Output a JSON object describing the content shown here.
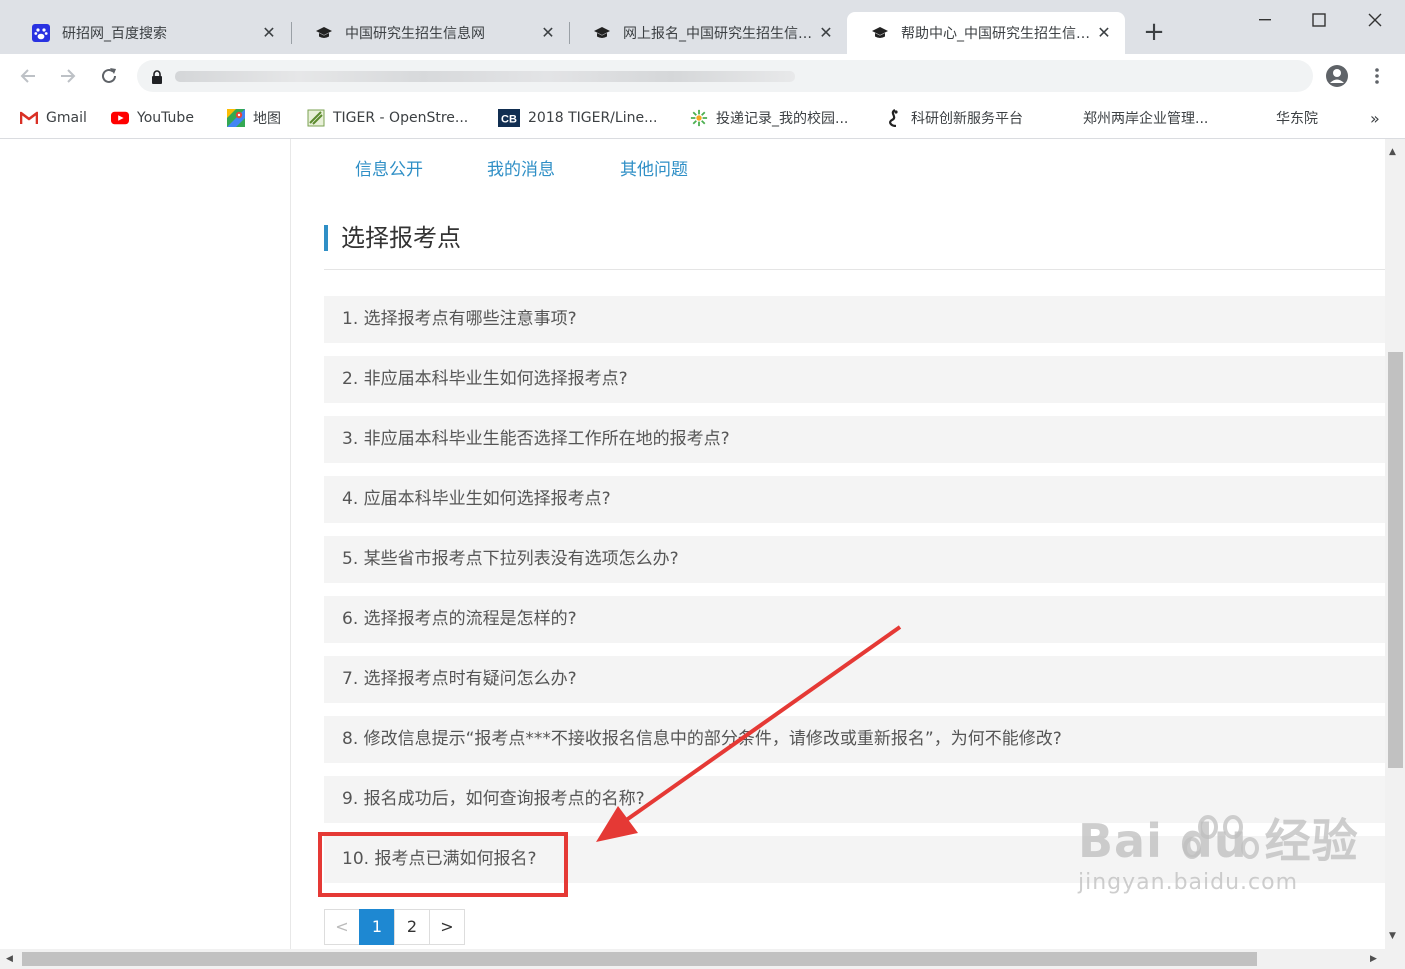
{
  "browser": {
    "tabs": [
      {
        "title": "研招网_百度搜索",
        "icon": "baidu-paw-icon",
        "active": false
      },
      {
        "title": "中国研究生招生信息网",
        "icon": "graduation-cap-icon",
        "active": false
      },
      {
        "title": "网上报名_中国研究生招生信息网",
        "icon": "graduation-cap-icon",
        "active": false
      },
      {
        "title": "帮助中心_中国研究生招生信息网",
        "icon": "graduation-cap-icon",
        "active": true
      }
    ],
    "bookmarks": [
      {
        "label": "Gmail",
        "icon": "gmail-icon"
      },
      {
        "label": "YouTube",
        "icon": "youtube-icon"
      },
      {
        "label": "地图",
        "icon": "maps-icon"
      },
      {
        "label": "TIGER - OpenStre...",
        "icon": "tiger-icon"
      },
      {
        "label": "2018 TIGER/Line...",
        "icon": "census-cb-icon"
      },
      {
        "label": "投递记录_我的校园...",
        "icon": "campus-icon"
      },
      {
        "label": "科研创新服务平台",
        "icon": "research-icon"
      },
      {
        "label": "郑州两岸企业管理...",
        "icon": ""
      },
      {
        "label": "华东院",
        "icon": ""
      }
    ],
    "bookmarks_overflow": "»"
  },
  "page": {
    "top_nav": [
      "信息公开",
      "我的消息",
      "其他问题"
    ],
    "section_title": "选择报考点",
    "questions": [
      "1. 选择报考点有哪些注意事项?",
      "2. 非应届本科毕业生如何选择报考点?",
      "3. 非应届本科毕业生能否选择工作所在地的报考点?",
      "4. 应届本科毕业生如何选择报考点?",
      "5. 某些省市报考点下拉列表没有选项怎么办?",
      "6. 选择报考点的流程是怎样的?",
      "7. 选择报考点时有疑问怎么办?",
      "8. 修改信息提示“报考点***不接收报名信息中的部分条件，请修改或重新报名”，为何不能修改?",
      "9. 报名成功后，如何查询报考点的名称?",
      "10. 报考点已满如何报名?"
    ],
    "pagination": {
      "prev": "<",
      "pages": [
        "1",
        "2"
      ],
      "current": "1",
      "next": ">"
    }
  },
  "watermark": {
    "main": "Bai du 经验",
    "sub": "jingyan.baidu.com"
  },
  "colors": {
    "accent": "#2f8fc6",
    "annotation": "#e53935",
    "current_page": "#1e88d2"
  }
}
